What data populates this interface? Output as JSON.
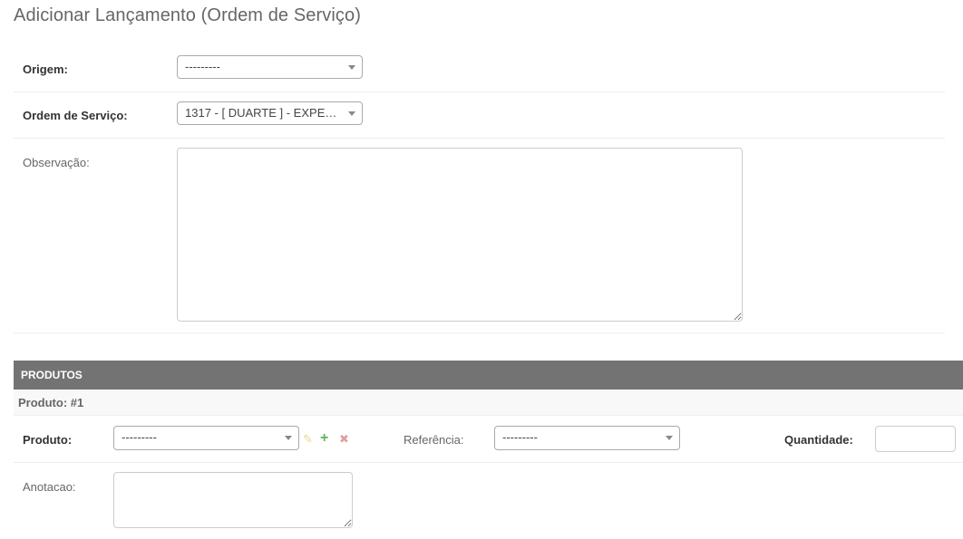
{
  "page": {
    "title": "Adicionar Lançamento (Ordem de Serviço)"
  },
  "form": {
    "origem": {
      "label": "Origem:",
      "value": "---------"
    },
    "ordem_servico": {
      "label": "Ordem de Serviço:",
      "value": "1317 - [ DUARTE ] - EXPEDI..."
    },
    "observacao": {
      "label": "Observação:",
      "value": ""
    }
  },
  "produtos": {
    "section_title": "PRODUTOS",
    "inline_title": "Produto: #1",
    "produto": {
      "label": "Produto:",
      "value": "---------"
    },
    "icons": {
      "edit": "pencil-icon",
      "add": "plus-icon",
      "delete": "close-icon"
    },
    "referencia": {
      "label": "Referência:",
      "value": "---------"
    },
    "quantidade": {
      "label": "Quantidade:",
      "value": ""
    },
    "anotacao": {
      "label": "Anotacao:",
      "value": ""
    }
  },
  "colors": {
    "section_bar": "#737373",
    "edit_icon": "#e8d88a",
    "add_icon": "#5cb85c",
    "delete_icon": "#e0a0a0"
  }
}
